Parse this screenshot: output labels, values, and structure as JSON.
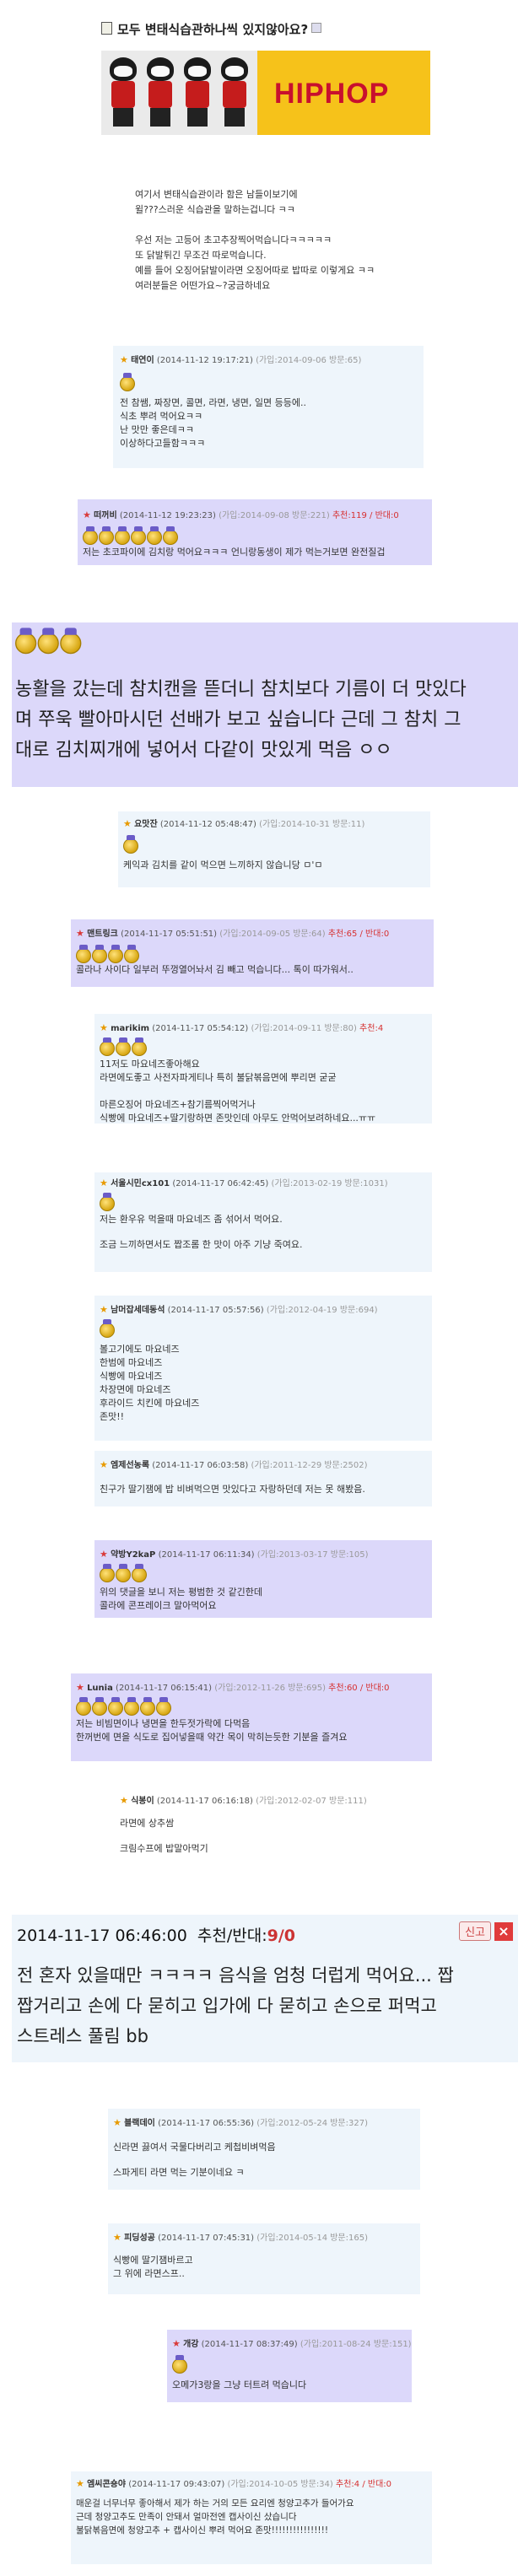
{
  "post": {
    "title": "모두 변태식습관하나씩 있지않아요?",
    "banner_text": "HIPHOP",
    "body": [
      "여기서 변태식습관이라 함은 남들이보기에",
      "윌???스러운 식습관을 말하는겁니다 ㅋㅋ",
      "",
      "우선 저는 고등어 초고추장찍어먹습니다ㅋㅋㅋㅋㅋ",
      "또 닭발튀긴 무조건 따로먹습니다.",
      "예를 들어 오징어닭발이라면 오징어따로 밥따로 이렇게요 ㅋㅋ",
      " 여러분들은 어떤가요~?궁금하네요"
    ]
  },
  "comments": [
    {
      "name": "태연이",
      "date": "(2014-11-12 19:17:21)",
      "meta": "(가입:2014-09-06 방문:65)",
      "medals": 1,
      "lines": [
        "전 참쌤, 짜장면, 콜면, 라면, 냉면, 일면 등등에..",
        "식초 뿌려 먹어요ㅋㅋ",
        "난 맛만 좋은데ㅋㅋ",
        "이상하다고들함ㅋㅋㅋ"
      ]
    },
    {
      "name": "떠꺼비",
      "date": "(2014-11-12 19:23:23)",
      "meta": "(가입:2014-09-08 방문:221)",
      "rec": "추천:119 / 반대:0",
      "medals": 6,
      "lines": [
        "저는 초코파이에 김치랑 먹어요ㅋㅋㅋ 언니랑동생이 제가 먹는거보면 완전질겁"
      ]
    },
    {
      "big": true,
      "medals": 3,
      "lines": [
        "농활을 갔는데 참치캔을 뜯더니 참치보다 기름이 더 맛있다",
        "며 쭈욱 빨아마시던 선배가 보고 싶습니다 근데 그 참치 그",
        "대로 김치찌개에 넣어서 다같이 맛있게 먹음 ㅇㅇ"
      ]
    },
    {
      "name": "요맛잔",
      "date": "(2014-11-12 05:48:47)",
      "meta": "(가입:2014-10-31 방문:11)",
      "medals": 1,
      "lines": [
        "케익과 김치를 같이 먹으면 느끼하지 않습니당 ㅁ'ㅁ"
      ]
    },
    {
      "name": "맨트링크",
      "date": "(2014-11-17 05:51:51)",
      "meta": "(가입:2014-09-05 방문:64)",
      "rec": "추천:65 / 반대:0",
      "medals": 4,
      "lines": [
        "콜라나 사이다 일부러 뚜껑열어놔서 김 빼고 먹습니다... 톡이 따가워서.."
      ]
    },
    {
      "name": "marikim",
      "date": "(2014-11-17 05:54:12)",
      "meta": "(가입:2014-09-11 방문:80)",
      "rec": "추천:4",
      "medals": 3,
      "lines": [
        "11저도 마요네즈좋아해요",
        "라면에도좋고 사전자파게티나 특히 불닭볶음면에 뿌리면 굳굳",
        "",
        "마른오징어 마요네즈+참기름찍어먹거나",
        "식빵에 마요네즈+딸기랑하면 존맛인데 아무도 안먹어보려하네요...ㅠㅠ"
      ]
    },
    {
      "name": "서울시민cx101",
      "date": "(2014-11-17 06:42:45)",
      "meta": "(가입:2013-02-19 방문:1031)",
      "medals": 1,
      "lines": [
        "저는 환우유 먹을때 마요네즈 좀 섞어서 먹어요.",
        "",
        "조금 느끼하면서도 짭조롬 한 맛이 아주 기냥 죽여요."
      ]
    },
    {
      "name": "남머잡세데동석",
      "date": "(2014-11-17 05:57:56)",
      "meta": "(가입:2012-04-19 방문:694)",
      "medals": 1,
      "lines": [
        "볼고기에도 마요네즈",
        "한범에 마요네즈",
        "식빵에 마요네즈",
        "차장면에 마요네즈",
        "후라이드 치킨에 마요네즈",
        "존맛!!"
      ]
    },
    {
      "name": "엠제선농록",
      "date": "(2014-11-17 06:03:58)",
      "meta": "(가입:2011-12-29 방문:2502)",
      "medals": 0,
      "lines": [
        "친구가 딸기잼에 밥 비벼먹으면 맛있다고 자랑하던데 저는 못 해봤음."
      ]
    },
    {
      "name": "약방Y2kaP",
      "date": "(2014-11-17 06:11:34)",
      "meta": "(가입:2013-03-17 방문:105)",
      "medals": 3,
      "lines": [
        "위의 댓글을 보니 저는 평범한 것 같긴한데",
        "콜라에 콘프레이크 말아먹어요"
      ]
    },
    {
      "name": "Lunia",
      "date": "(2014-11-17 06:15:41)",
      "meta": "(가입:2012-11-26 방문:695)",
      "rec": "추천:60 / 반대:0",
      "medals": 6,
      "lines": [
        "저는 비빔면이나 냉면을 한두젓가락에 다먹음",
        "한꺼번에 면을 식도로 집어넣을때 약간 목이 막히는듯한 기분을 즐겨요"
      ]
    },
    {
      "name": "식봉이",
      "date": "(2014-11-17 06:16:18)",
      "meta": "(가입:2012-02-07 방문:111)",
      "medals": 0,
      "lines": [
        "라면에 상추쌈",
        "",
        "크림수프에 밥말아먹기"
      ]
    },
    {
      "bighead": true,
      "date": "2014-11-17 06:46:00",
      "rec_label": "추천/반대:",
      "rec_val": "9/0",
      "report": "신고",
      "close": "×",
      "lines": [
        "전 혼자 있을때만 ㅋㅋㅋㅋ 음식을 엄청 더럽게 먹어요... 짭",
        "짭거리고 손에 다 묻히고 입가에 다 묻히고 손으로 퍼먹고",
        "스트레스 풀림 bb"
      ]
    },
    {
      "name": "블랙데이",
      "date": "(2014-11-17 06:55:36)",
      "meta": "(가입:2012-05-24 방문:327)",
      "medals": 0,
      "lines": [
        "신라면 끓여서 국물다버리고 케첩비벼먹음",
        "",
        "스파게티 라면 먹는 기분이네요 ㅋ"
      ]
    },
    {
      "name": "피딩성공",
      "date": "(2014-11-17 07:45:31)",
      "meta": "(가입:2014-05-14 방문:165)",
      "medals": 0,
      "lines": [
        "식빵에 딸기잼바르고",
        "그 위에 라면스프.."
      ]
    },
    {
      "name": "개강",
      "date": "(2014-11-17 08:37:49)",
      "meta": "(가입:2011-08-24 방문:151)",
      "medals": 1,
      "lines": [
        "오메가3랑을 그냥 터트려 먹습니다"
      ]
    },
    {
      "name": "엠씨콘숑야",
      "date": "(2014-11-17 09:43:07)",
      "meta": "(가입:2014-10-05 방문:34)",
      "rec": "추천:4 / 반대:0",
      "medals": 0,
      "lines": [
        "매운걸 너무너무 좋아해서 제가 하는 거의 모든 요리엔 청양고추가 들어가요",
        "근데 청양고추도 만족이 안돼서 얼마전엔 캡사이신 샀습니다",
        "불닭볶음면에 청양고추 + 캡사이신 뿌려 먹어요 존맛!!!!!!!!!!!!!!!!"
      ]
    }
  ]
}
